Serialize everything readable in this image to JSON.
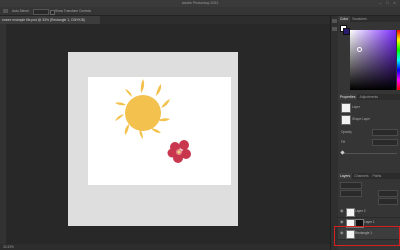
{
  "app": {
    "title": "Adobe Photoshop 2022",
    "window_controls": [
      "–",
      "□",
      "×"
    ]
  },
  "options_bar": {
    "auto_select_label": "Auto-Select:",
    "auto_select_value": "Layer",
    "transform_label": "Show Transform Controls"
  },
  "document": {
    "tab_label": "smore example file.psd @ 33% (Rectangle 1, CMYK/8)"
  },
  "statusbar": {
    "text": "33.33%"
  },
  "panels": {
    "color_tabs": [
      "Color",
      "Swatches"
    ],
    "properties_tabs": [
      "Properties",
      "Adjustments"
    ],
    "properties": {
      "layer_label": "Layer",
      "shape_label": "Shape Layer",
      "opacity_label": "Opacity",
      "fill_label": "Fill"
    },
    "layers_tabs": [
      "Layers",
      "Channels",
      "Paths"
    ],
    "layers_search": "Kind",
    "layers": [
      {
        "name": "Layer 2"
      },
      {
        "name": "Layer 1"
      },
      {
        "name": "Rectangle 1"
      }
    ]
  },
  "colors": {
    "accent_highlight": "#d61f1f",
    "sun": "#f2c14e",
    "flower": "#c8374e"
  }
}
